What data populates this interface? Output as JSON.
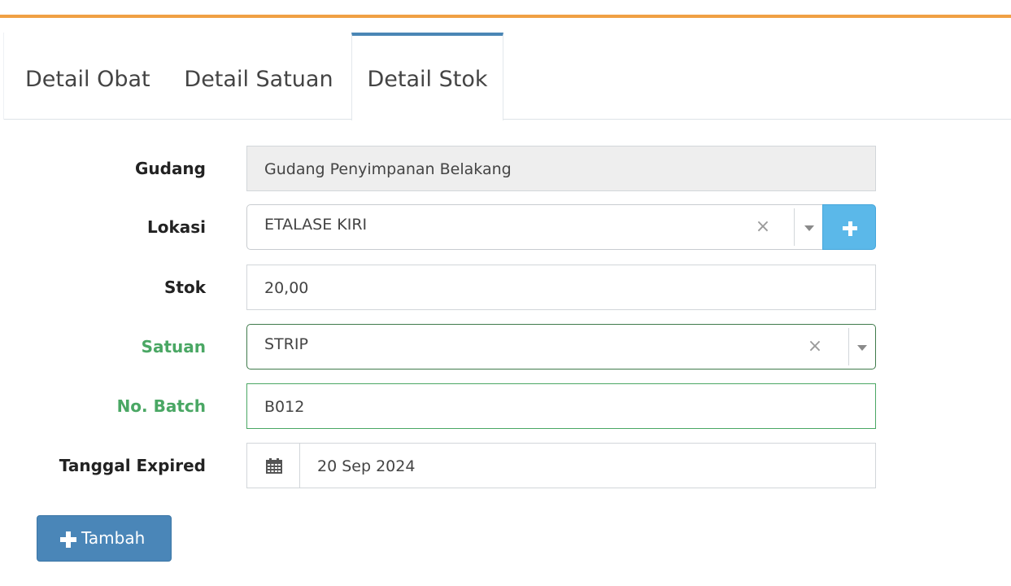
{
  "tabs": [
    {
      "label": "Detail Obat"
    },
    {
      "label": "Detail Satuan"
    },
    {
      "label": "Detail Stok",
      "active": true
    }
  ],
  "form": {
    "gudang": {
      "label": "Gudang",
      "value": "Gudang Penyimpanan Belakang"
    },
    "lokasi": {
      "label": "Lokasi",
      "value": "ETALASE KIRI",
      "clear": "×"
    },
    "stok": {
      "label": "Stok",
      "value": "20,00"
    },
    "satuan": {
      "label": "Satuan",
      "value": "STRIP",
      "clear": "×"
    },
    "batch": {
      "label": "No. Batch",
      "value": "B012"
    },
    "expired": {
      "label": "Tanggal Expired",
      "value": "20 Sep 2024"
    }
  },
  "actions": {
    "tambah_label": "Tambah"
  },
  "colors": {
    "accent_top": "#f0a044",
    "active_tab": "#4a86b5",
    "success": "#4aa764",
    "add_button": "#5bb8e9",
    "primary_button": "#4a86b8"
  },
  "icons": {
    "add": "plus-icon",
    "date": "calendar-icon",
    "clear": "close-icon",
    "dropdown": "caret-down-icon"
  }
}
